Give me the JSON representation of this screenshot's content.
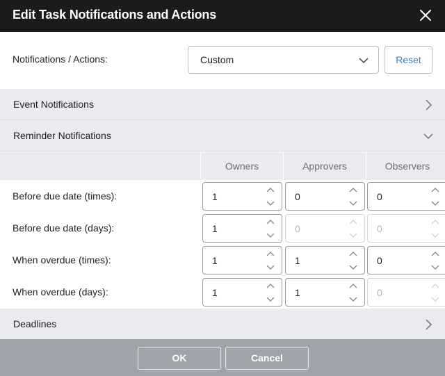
{
  "dialog": {
    "title": "Edit Task Notifications and Actions",
    "close_icon": "close-icon"
  },
  "notifications_actions": {
    "label": "Notifications / Actions:",
    "selected": "Custom",
    "reset_label": "Reset"
  },
  "sections": {
    "event": {
      "title": "Event Notifications",
      "expanded": false
    },
    "reminder": {
      "title": "Reminder Notifications",
      "expanded": true
    },
    "deadlines": {
      "title": "Deadlines",
      "expanded": false
    }
  },
  "reminder_table": {
    "columns": [
      "Owners",
      "Approvers",
      "Observers"
    ],
    "rows": [
      {
        "label": "Before due date (times):",
        "values": [
          "1",
          "0",
          "0"
        ],
        "disabled": [
          false,
          false,
          false
        ]
      },
      {
        "label": "Before due date (days):",
        "values": [
          "1",
          "0",
          "0"
        ],
        "disabled": [
          false,
          true,
          true
        ]
      },
      {
        "label": "When overdue (times):",
        "values": [
          "1",
          "1",
          "0"
        ],
        "disabled": [
          false,
          false,
          false
        ]
      },
      {
        "label": "When overdue (days):",
        "values": [
          "1",
          "1",
          "0"
        ],
        "disabled": [
          false,
          false,
          true
        ]
      }
    ]
  },
  "footer": {
    "ok_label": "OK",
    "cancel_label": "Cancel"
  },
  "colors": {
    "titlebar": "#1b1b1b",
    "section_bg": "#e9ebee",
    "link": "#3d7fb8",
    "footer": "#9fa4ab"
  }
}
